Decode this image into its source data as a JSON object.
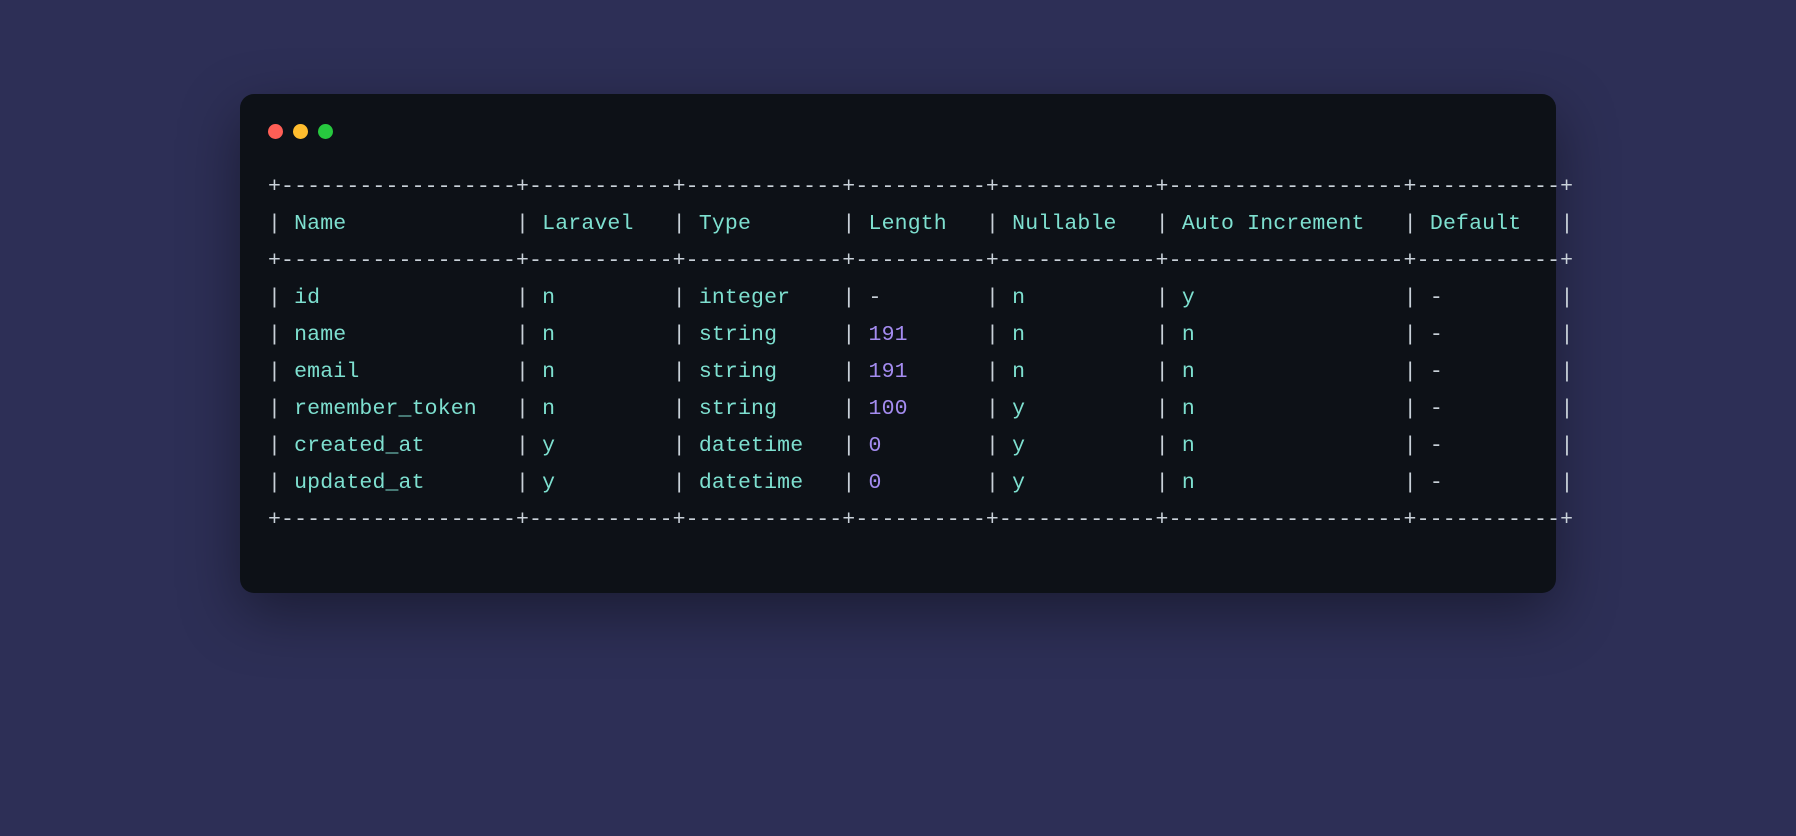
{
  "table": {
    "headers": [
      "Name",
      "Laravel",
      "Type",
      "Length",
      "Nullable",
      "Auto Increment",
      "Default"
    ],
    "rows": [
      {
        "name": "id",
        "laravel": "n",
        "type": "integer",
        "length": "-",
        "nullable": "n",
        "auto_increment": "y",
        "default": "-"
      },
      {
        "name": "name",
        "laravel": "n",
        "type": "string",
        "length": "191",
        "nullable": "n",
        "auto_increment": "n",
        "default": "-"
      },
      {
        "name": "email",
        "laravel": "n",
        "type": "string",
        "length": "191",
        "nullable": "n",
        "auto_increment": "n",
        "default": "-"
      },
      {
        "name": "remember_token",
        "laravel": "n",
        "type": "string",
        "length": "100",
        "nullable": "y",
        "auto_increment": "n",
        "default": "-"
      },
      {
        "name": "created_at",
        "laravel": "y",
        "type": "datetime",
        "length": "0",
        "nullable": "y",
        "auto_increment": "n",
        "default": "-"
      },
      {
        "name": "updated_at",
        "laravel": "y",
        "type": "datetime",
        "length": "0",
        "nullable": "y",
        "auto_increment": "n",
        "default": "-"
      }
    ]
  },
  "colors": {
    "bg": "#2d2f56",
    "terminal_bg": "#0d1117",
    "border": "#c9d1d9",
    "header": "#7ee0d0",
    "cyan": "#7ee0d0",
    "purple": "#a48cf0"
  }
}
